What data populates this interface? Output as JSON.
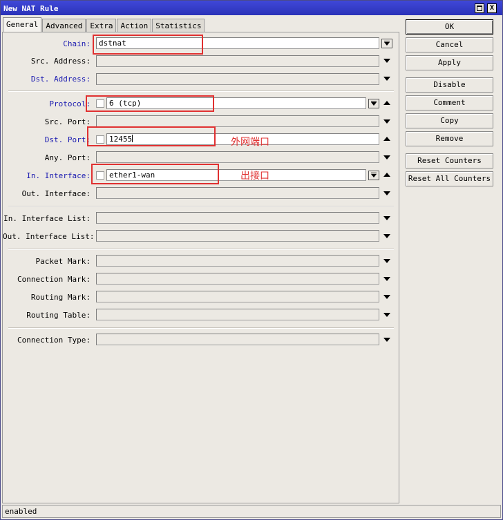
{
  "window": {
    "title": "New NAT Rule",
    "restore_icon": "restore-icon",
    "close_icon": "close-icon",
    "close_glyph": "X"
  },
  "tabs": [
    {
      "label": "General",
      "active": true
    },
    {
      "label": "Advanced"
    },
    {
      "label": "Extra"
    },
    {
      "label": "Action"
    },
    {
      "label": "Statistics"
    }
  ],
  "fields": {
    "chain": {
      "label": "Chain:",
      "value": "dstnat"
    },
    "src_address": {
      "label": "Src. Address:"
    },
    "dst_address": {
      "label": "Dst. Address:"
    },
    "protocol": {
      "label": "Protocol:",
      "value": "6 (tcp)"
    },
    "src_port": {
      "label": "Src. Port:"
    },
    "dst_port": {
      "label": "Dst. Port:",
      "value": "12455"
    },
    "any_port": {
      "label": "Any. Port:"
    },
    "in_interface": {
      "label": "In. Interface:",
      "value": "ether1-wan"
    },
    "out_interface": {
      "label": "Out. Interface:"
    },
    "in_interface_list": {
      "label": "In. Interface List:"
    },
    "out_interface_list": {
      "label": "Out. Interface List:"
    },
    "packet_mark": {
      "label": "Packet Mark:"
    },
    "connection_mark": {
      "label": "Connection Mark:"
    },
    "routing_mark": {
      "label": "Routing Mark:"
    },
    "routing_table": {
      "label": "Routing Table:"
    },
    "connection_type": {
      "label": "Connection Type:"
    }
  },
  "buttons": {
    "ok": "OK",
    "cancel": "Cancel",
    "apply": "Apply",
    "disable": "Disable",
    "comment": "Comment",
    "copy": "Copy",
    "remove": "Remove",
    "reset_counters": "Reset Counters",
    "reset_all_counters": "Reset All Counters"
  },
  "annotations": {
    "dst_port_note": "外网端口",
    "in_interface_note": "出接口",
    "color": "#e03030"
  },
  "status": {
    "text": "enabled"
  },
  "colors": {
    "title_bar": "#2b32b8",
    "highlight_label": "#1a1ab0",
    "window_bg": "#ece9e3"
  }
}
